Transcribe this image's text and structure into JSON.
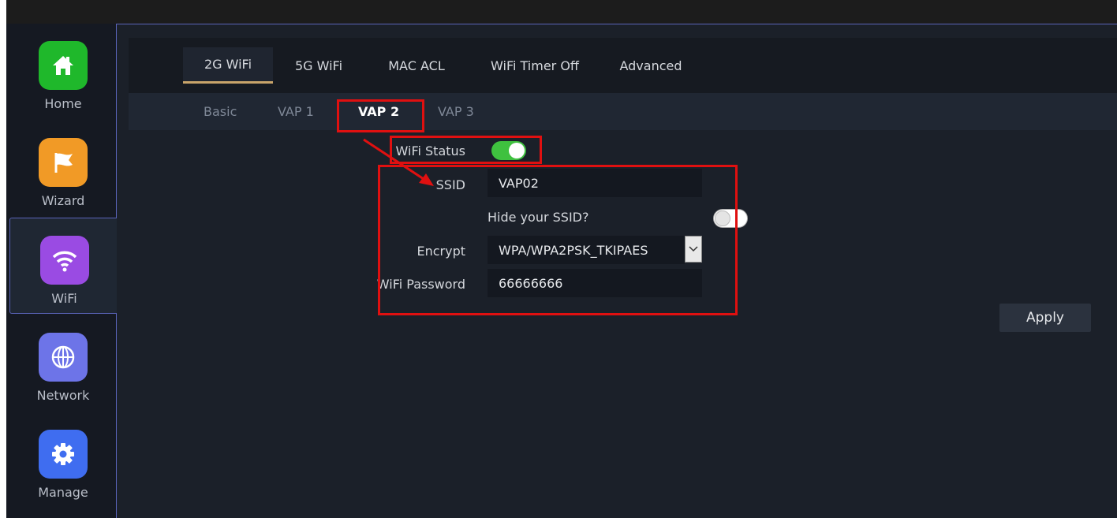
{
  "colors": {
    "accent_underline": "#c8a46a",
    "annotation_red": "#e01010",
    "toggle_on": "#3fc13f",
    "home_icon_bg": "#1fb82b",
    "wizard_icon_bg": "#f19a26",
    "wifi_icon_bg": "#9a4be3",
    "network_icon_bg": "#6d74e8",
    "manage_icon_bg": "#3f6df0"
  },
  "sidebar": {
    "items": [
      {
        "label": "Home",
        "icon": "home-icon"
      },
      {
        "label": "Wizard",
        "icon": "flag-icon"
      },
      {
        "label": "WiFi",
        "icon": "wifi-icon"
      },
      {
        "label": "Network",
        "icon": "globe-icon"
      },
      {
        "label": "Manage",
        "icon": "gear-icon"
      }
    ]
  },
  "tabs": [
    {
      "label": "2G WiFi"
    },
    {
      "label": "5G WiFi"
    },
    {
      "label": "MAC ACL"
    },
    {
      "label": "WiFi Timer Off"
    },
    {
      "label": "Advanced"
    }
  ],
  "subtabs": [
    {
      "label": "Basic"
    },
    {
      "label": "VAP 1"
    },
    {
      "label": "VAP 2"
    },
    {
      "label": "VAP 3"
    }
  ],
  "form": {
    "wifi_status_label": "WiFi Status",
    "wifi_status_on": true,
    "ssid_label": "SSID",
    "ssid_value": "VAP02",
    "hide_ssid_label": "Hide your SSID?",
    "hide_ssid_on": false,
    "encrypt_label": "Encrypt",
    "encrypt_value": "WPA/WPA2PSK_TKIPAES",
    "password_label": "WiFi Password",
    "password_value": "66666666"
  },
  "apply_label": "Apply"
}
